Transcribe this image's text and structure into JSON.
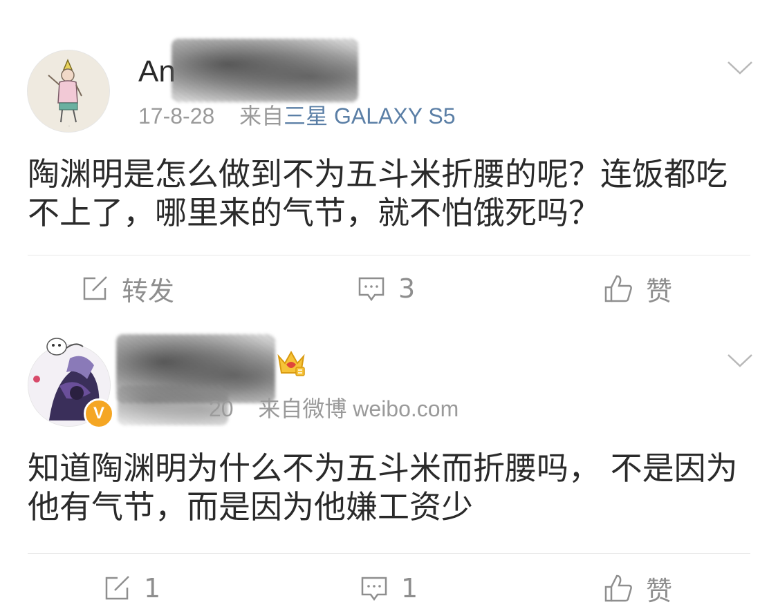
{
  "posts": [
    {
      "username_visible": "An",
      "date": "17-8-28",
      "source_prefix": "来自",
      "source": "三星 GALAXY S5",
      "content": "陶渊明是怎么做到不为五斗米折腰的呢？连饭都吃不上了，哪里来的气节，就不怕饿死吗？",
      "actions": {
        "repost": "转发",
        "comments": "3",
        "like": "赞"
      }
    },
    {
      "username_visible": "",
      "date": "20",
      "source_prefix": "来自微博",
      "source": "weibo.com",
      "verified_badge": "V",
      "content": "知道陶渊明为什么不为五斗米而折腰吗， 不是因为他有气节，而是因为他嫌工资少",
      "actions": {
        "repost": "1",
        "comments": "1",
        "like": "赞"
      }
    }
  ],
  "colors": {
    "meta_gray": "#9a9a9a",
    "source_link": "#5b7fa6",
    "badge_orange": "#f5a623",
    "action_gray": "#8e8e8e"
  },
  "icons": [
    "chevron-down-icon",
    "repost-icon",
    "comment-icon",
    "like-icon",
    "crown-icon"
  ]
}
